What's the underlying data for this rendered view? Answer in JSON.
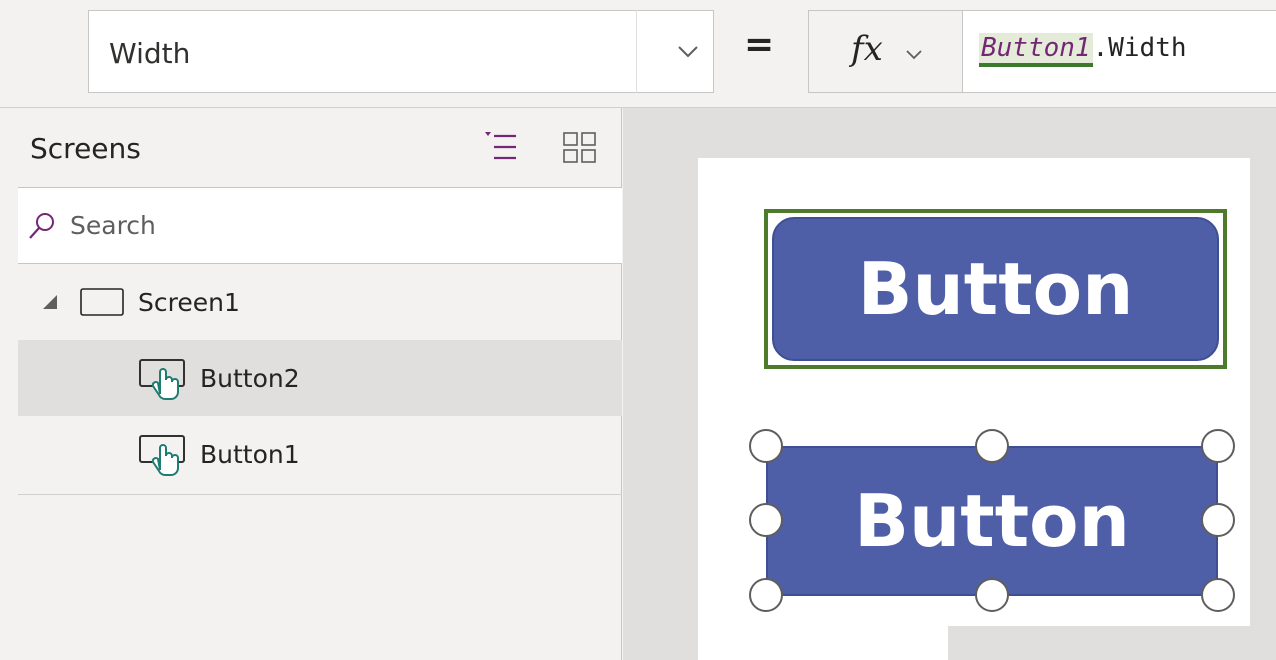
{
  "formula_bar": {
    "property": "Width",
    "equals": "=",
    "fx_label": "fx",
    "formula_token": "Button1",
    "formula_rest": ".Width"
  },
  "tree_view": {
    "title": "Screens",
    "search_placeholder": "Search",
    "items": [
      {
        "label": "Screen1",
        "type": "screen",
        "expanded": true
      },
      {
        "label": "Button2",
        "type": "button",
        "selected": true
      },
      {
        "label": "Button1",
        "type": "button",
        "selected": false
      }
    ]
  },
  "canvas": {
    "button_top_label": "Button",
    "button_bottom_label": "Button"
  },
  "colors": {
    "accent_purple": "#742774",
    "button_fill": "#4f5fa7",
    "reference_highlight": "#4e7a2c",
    "icon_teal": "#1e7c72"
  },
  "icons": [
    "chevron-down-icon",
    "fx-chevron-icon",
    "tree-view-icon",
    "thumbnail-view-icon",
    "search-icon",
    "expand-caret-icon",
    "screen-icon",
    "button-control-icon"
  ]
}
